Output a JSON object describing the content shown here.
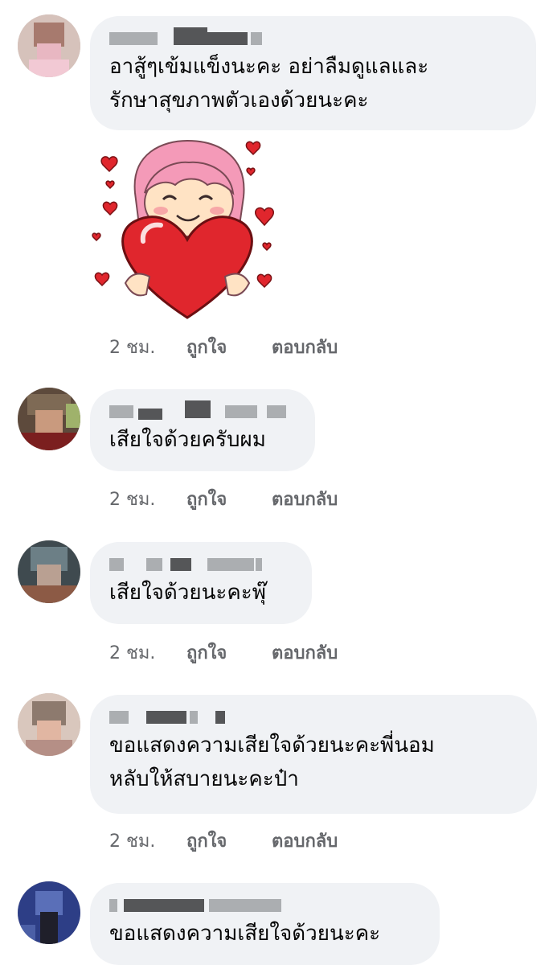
{
  "comments": [
    {
      "text": "อาสู้ๆเข้มแข็งนะคะ อย่าลืมดูแลและ\nรักษาสุขภาพตัวเองด้วยนะคะ",
      "has_sticker": true,
      "sticker_icon": "heart-hug-girl-sticker",
      "time": "2 ชม.",
      "like": "ถูกใจ",
      "reply": "ตอบกลับ"
    },
    {
      "text": "เสียใจด้วยครับผม",
      "time": "2 ชม.",
      "like": "ถูกใจ",
      "reply": "ตอบกลับ"
    },
    {
      "text": "เสียใจด้วยนะคะพุ๊",
      "time": "2 ชม.",
      "like": "ถูกใจ",
      "reply": "ตอบกลับ"
    },
    {
      "text": "ขอแสดงความเสียใจด้วยนะคะพี่นอม\nหลับให้สบายนะคะป๋า",
      "time": "2 ชม.",
      "like": "ถูกใจ",
      "reply": "ตอบกลับ"
    },
    {
      "text": "ขอแสดงความเสียใจด้วยนะคะ"
    }
  ],
  "colors": {
    "bubble": "#f0f2f5",
    "text": "#050505",
    "meta": "#65676b",
    "heart": "#e0262d",
    "hair": "#f49ab8"
  }
}
